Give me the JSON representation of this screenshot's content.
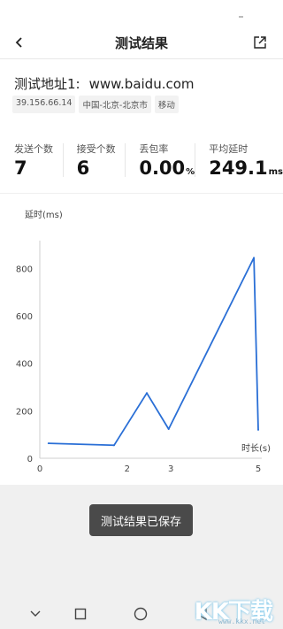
{
  "header": {
    "title": "测试结果",
    "back_icon": "chevron-left-icon",
    "share_icon": "share-icon"
  },
  "target": {
    "label": "测试地址1:",
    "url": "www.baidu.com",
    "tags": [
      "39.156.66.14",
      "中国-北京-北京市",
      "移动"
    ]
  },
  "stats": [
    {
      "label": "发送个数",
      "value": "7",
      "unit": ""
    },
    {
      "label": "接受个数",
      "value": "6",
      "unit": ""
    },
    {
      "label": "丢包率",
      "value": "0.00",
      "unit": "%"
    },
    {
      "label": "平均延时",
      "value": "249.1",
      "unit": "ms"
    }
  ],
  "chart_data": {
    "type": "line",
    "ylabel": "延时(ms)",
    "xlabel": "时长(s)",
    "x": [
      0.2,
      1.7,
      2.45,
      2.95,
      4.9,
      5.0
    ],
    "y": [
      63,
      55,
      275,
      123,
      845,
      120
    ],
    "xlim": [
      0,
      5
    ],
    "ylim": [
      0,
      880
    ],
    "xticks": [
      0,
      2,
      3,
      5
    ],
    "yticks": [
      0,
      200,
      400,
      600,
      800
    ],
    "color": "#2a6fd6",
    "grid": false
  },
  "toast": {
    "text": "测试结果已保存"
  },
  "navbar": {
    "icons": [
      "chevron-down-icon",
      "square-icon",
      "circle-icon",
      "triangle-back-icon"
    ]
  },
  "watermark": {
    "logo": "KK下载",
    "url": "www.kkx.net"
  }
}
